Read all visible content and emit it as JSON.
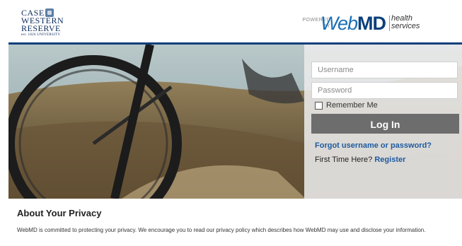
{
  "header": {
    "logo": {
      "line1": "CASE",
      "line2": "WESTERN",
      "line3": "RESERVE",
      "line4": "est. 1826 UNIVERSITY"
    },
    "powered_label": "POWERED BY",
    "brand_light": "Web",
    "brand_bold": "MD",
    "health_line1": "health",
    "health_line2": "services"
  },
  "login": {
    "username_placeholder": "Username",
    "password_placeholder": "Password",
    "remember_label": "Remember Me",
    "login_button": "Log In",
    "forgot_link": "Forgot username or password?",
    "first_time_text": "First Time Here?",
    "register_link": "Register"
  },
  "privacy": {
    "title": "About Your Privacy",
    "text": "WebMD is committed to protecting your privacy. We encourage you to read our privacy policy which describes how WebMD may use and disclose your information."
  },
  "colors": {
    "brand_navy": "#0b3f7a",
    "link_blue": "#1e5aa0",
    "button_gray": "#6d6d6d"
  }
}
